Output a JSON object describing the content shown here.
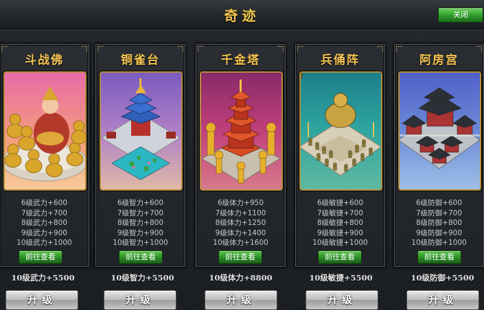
{
  "window": {
    "title": "奇迹",
    "close_label": "关闭"
  },
  "cards": [
    {
      "name": "斗战佛",
      "stats": [
        "6级武力+600",
        "7级武力+700",
        "8级武力+800",
        "9级武力+900",
        "10级武力+1000"
      ],
      "goto_label": "前往查看",
      "total": "10级武力+5500",
      "upgrade_label": "升级"
    },
    {
      "name": "铜雀台",
      "stats": [
        "6级智力+600",
        "7级智力+700",
        "8级智力+800",
        "9级智力+900",
        "10级智力+1000"
      ],
      "goto_label": "前往查看",
      "total": "10级智力+5500",
      "upgrade_label": "升级"
    },
    {
      "name": "千金塔",
      "stats": [
        "6级体力+950",
        "7级体力+1100",
        "8级体力+1250",
        "9级体力+1400",
        "10级体力+1600"
      ],
      "goto_label": "前往查看",
      "total": "10级体力+8800",
      "upgrade_label": "升级"
    },
    {
      "name": "兵俑阵",
      "stats": [
        "6级敏捷+600",
        "7级敏捷+700",
        "8级敏捷+800",
        "9级敏捷+900",
        "10级敏捷+1000"
      ],
      "goto_label": "前往查看",
      "total": "10级敏捷+5500",
      "upgrade_label": "升级"
    },
    {
      "name": "阿房宫",
      "stats": [
        "6级防御+600",
        "7级防御+700",
        "8级防御+800",
        "9级防御+900",
        "10级防御+1000"
      ],
      "goto_label": "前往查看",
      "total": "10级防御+5500",
      "upgrade_label": "升级"
    }
  ],
  "colors": {
    "title_gold": "#f0c64a",
    "button_green": "#2f9a2b",
    "art_frame": "#b88f3b"
  }
}
